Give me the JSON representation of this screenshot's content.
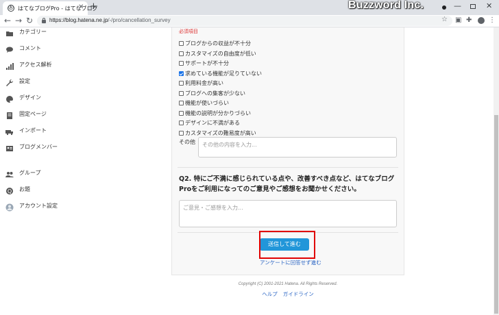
{
  "browser": {
    "tab_title": "はてなブログPro - はてなブログ",
    "tab_favicon": "ⓗ",
    "url_domain": "https://blog.hatena.ne.jp",
    "url_path": "/-/pro/cancellation_survey",
    "watermark": "Buzzword Inc."
  },
  "sidebar": {
    "items": [
      {
        "label": "カテゴリー",
        "icon": "folder-icon"
      },
      {
        "label": "コメント",
        "icon": "comment-icon"
      },
      {
        "label": "アクセス解析",
        "icon": "bar-chart-icon"
      },
      {
        "label": "設定",
        "icon": "wrench-icon"
      },
      {
        "label": "デザイン",
        "icon": "palette-icon"
      },
      {
        "label": "固定ページ",
        "icon": "page-icon"
      },
      {
        "label": "インポート",
        "icon": "truck-icon"
      },
      {
        "label": "ブログメンバー",
        "icon": "id-card-icon"
      },
      {
        "label": "グループ",
        "icon": "group-icon"
      },
      {
        "label": "お題",
        "icon": "topic-icon"
      },
      {
        "label": "アカウント設定",
        "icon": "account-icon"
      }
    ]
  },
  "survey": {
    "required_label": "必須項目",
    "options": [
      {
        "label": "ブログからの収益が不十分",
        "checked": false
      },
      {
        "label": "カスタマイズの自由度が低い",
        "checked": false
      },
      {
        "label": "サポートが不十分",
        "checked": false
      },
      {
        "label": "求めている機能が足りていない",
        "checked": true
      },
      {
        "label": "利用料金が高い",
        "checked": false
      },
      {
        "label": "ブログへの集客が少ない",
        "checked": false
      },
      {
        "label": "機能が使いづらい",
        "checked": false
      },
      {
        "label": "機能の説明が分かりづらい",
        "checked": false
      },
      {
        "label": "デザインに不満がある",
        "checked": false
      },
      {
        "label": "カスタマイズの難易度が高い",
        "checked": false
      }
    ],
    "other_label": "その他",
    "other_placeholder": "その他の内容を入力...",
    "q2_title": "Q2. 特にご不満に感じられている点や、改善すべき点など、はてなブログProをご利用になってのご意見やご感想をお聞かせください。",
    "q2_placeholder": "ご意見・ご感想を入力...",
    "submit_label": "送信して進む",
    "skip_label": "アンケートに回答せず進む"
  },
  "footer": {
    "copyright": "Copyright (C) 2001-2021 Hatena. All Rights Reserved.",
    "help": "ヘルプ",
    "guide": "ガイドライン"
  },
  "colors": {
    "submit": "#2196d9",
    "highlight": "#e00000",
    "required": "#dd3333"
  }
}
